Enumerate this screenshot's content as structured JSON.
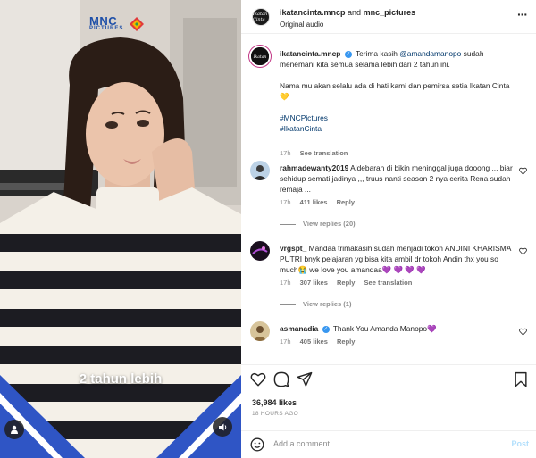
{
  "media": {
    "logo_text": "MNC",
    "logo_sub": "PICTURES",
    "caption": "2 tahun lebih",
    "user_icon": "user-icon",
    "sound_icon": "speaker-icon"
  },
  "header": {
    "avatar_text": "Ikatan Cinta",
    "account1": "ikatancinta.mncp",
    "connector": "and",
    "account2": "mnc_pictures",
    "audio": "Original audio",
    "more_icon": "more-options-icon"
  },
  "post": {
    "username": "ikatancinta.mncp",
    "text_1": "Terima kasih",
    "mention": "@amandamanopo",
    "text_2": "sudah menemani kita semua selama lebih dari 2 tahun ini.",
    "text_3": "Nama mu akan selalu ada di hati kami dan pemirsa setia Ikatan Cinta💛",
    "hashtag1": "#MNCPictures",
    "hashtag2": "#IkatanCinta",
    "time": "17h",
    "see_translation": "See translation"
  },
  "comments": [
    {
      "username": "rahmadewanty2019",
      "text": "Aldebaran di bikin meninggal juga dooong ,,, biar sehidup semati jadinya ,,, truus nanti season 2 nya cerita Rena sudah remaja ...",
      "time": "17h",
      "likes": "411 likes",
      "reply": "Reply",
      "view_replies": "View replies (20)"
    },
    {
      "username": "vrgspt_",
      "text": "Mandaa trimakasih sudah menjadi tokoh ANDINI KHARISMA PUTRI bnyk pelajaran yg bisa kita ambil dr tokoh Andin thx you so much😭 we love you amandaa💜 💜 💜 💜",
      "time": "17h",
      "likes": "307 likes",
      "reply": "Reply",
      "see_translation": "See translation",
      "view_replies": "View replies (1)"
    },
    {
      "username": "asmanadia",
      "text": "Thank You Amanda Manopo💜",
      "time": "17h",
      "likes": "405 likes",
      "reply": "Reply"
    }
  ],
  "stats": {
    "likes": "36,984 likes",
    "ago": "18 HOURS AGO"
  },
  "add_comment": {
    "placeholder": "Add a comment...",
    "post_label": "Post"
  },
  "colors": {
    "link": "#00376b",
    "muted": "#8e8e8e",
    "verified": "#3897f0",
    "post_disabled": "#b2dffc"
  }
}
